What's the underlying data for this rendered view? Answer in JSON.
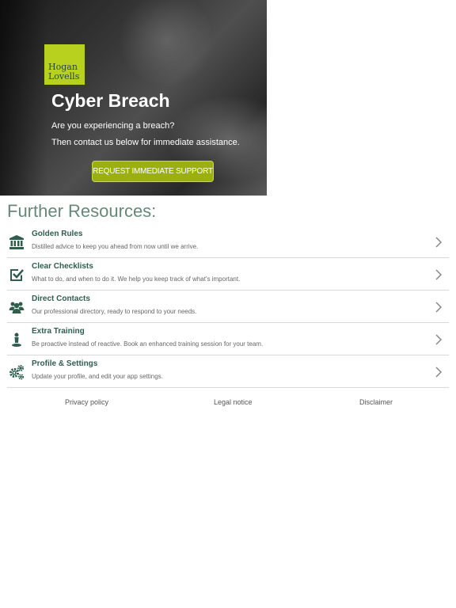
{
  "hero": {
    "logo_lines": [
      "Hogan",
      "Lovells"
    ],
    "title": "Cyber Breach",
    "line1": "Are you experiencing a breach?",
    "line2": "Then contact us below for immediate assistance.",
    "cta_label": "REQUEST IMMEDIATE SUPPORT",
    "brand_color": "#b8d01e",
    "cta_color": "#9bb00f"
  },
  "resources": {
    "heading": "Further Resources:",
    "items": [
      {
        "title": "Golden Rules",
        "description": "Distilled advice to keep you ahead from now until we arrive.",
        "icon": "bank-icon"
      },
      {
        "title": "Clear Checklists",
        "description": "What to do, and when to do it. We help you keep track of what's important.",
        "icon": "checkbox-icon"
      },
      {
        "title": "Direct Contacts",
        "description": "Our professional directory, ready to respond to your needs.",
        "icon": "users-icon"
      },
      {
        "title": "Extra Training",
        "description": "Be proactive instead of reactive. Book an enhanced training session for your team.",
        "icon": "training-icon"
      },
      {
        "title": "Profile & Settings",
        "description": "Update your profile, and edit your app settings.",
        "icon": "gears-icon"
      }
    ],
    "accent_color": "#2f5e4c",
    "heading_color": "#668977"
  },
  "footer": {
    "privacy": "Privacy policy",
    "legal": "Legal notice",
    "disclaimer": "Disclaimer"
  }
}
